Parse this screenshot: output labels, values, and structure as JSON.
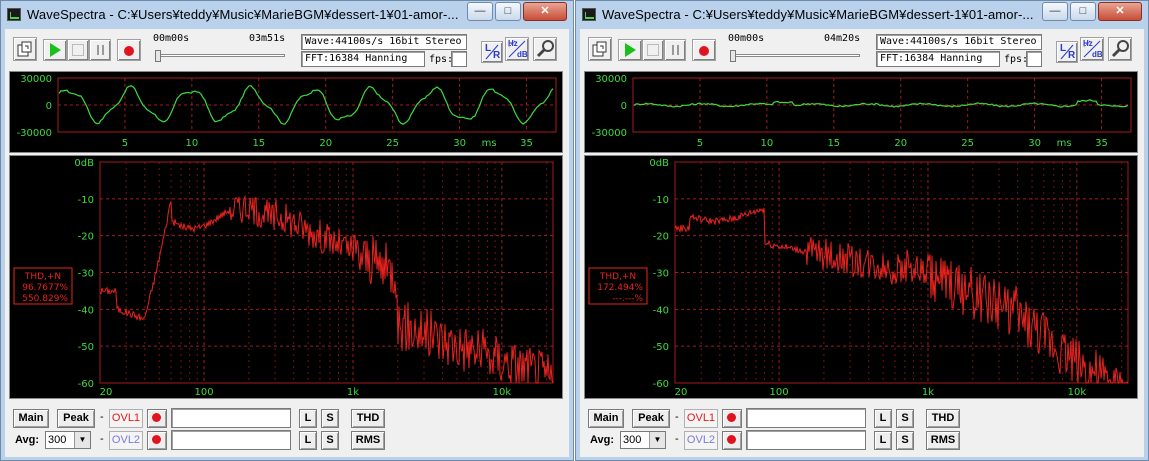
{
  "windows": [
    {
      "title": "WaveSpectra - C:¥Users¥teddy¥Music¥MarieBGM¥dessert-1¥01-amor-...",
      "titlebar_buttons": {
        "min": "—",
        "max": "□",
        "close": "✕"
      },
      "time_start": "00m00s",
      "time_end": "03m51s",
      "wave_info": "Wave:44100s/s 16bit Stereo",
      "fft_info": "FFT:16384 Hanning",
      "fps_label": "fps:",
      "lr_left": "L",
      "lr_right": "R",
      "hz_top": "Hz",
      "hz_bottom": "dB",
      "osc": {
        "y_labels": [
          "30000",
          "0",
          "-30000"
        ],
        "x_labels": [
          "5",
          "10",
          "15",
          "20",
          "25",
          "30",
          "35"
        ],
        "x_unit": "ms"
      },
      "spectrum": {
        "y_labels": [
          "0dB",
          "-10",
          "-20",
          "-30",
          "-40",
          "-50",
          "-60"
        ],
        "x_labels": [
          "20",
          "100",
          "1k",
          "10k"
        ],
        "thd_title": "THD,+N",
        "thd_value1": "96.7677%",
        "thd_value2": "550.829%"
      },
      "bottom": {
        "main": "Main",
        "peak": "Peak",
        "dash1": "-",
        "ovl1": "OVL1",
        "avg_label": "Avg:",
        "avg_value": "300",
        "dash2": "-",
        "ovl2": "OVL2",
        "l": "L",
        "s": "S",
        "thd": "THD",
        "rms": "RMS"
      }
    },
    {
      "title": "WaveSpectra - C:¥Users¥teddy¥Music¥MarieBGM¥dessert-1¥01-amor-...",
      "titlebar_buttons": {
        "min": "—",
        "max": "□",
        "close": "✕"
      },
      "time_start": "00m00s",
      "time_end": "04m20s",
      "wave_info": "Wave:44100s/s 16bit Stereo",
      "fft_info": "FFT:16384 Hanning",
      "fps_label": "fps:",
      "lr_left": "L",
      "lr_right": "R",
      "hz_top": "Hz",
      "hz_bottom": "dB",
      "osc": {
        "y_labels": [
          "30000",
          "0",
          "-30000"
        ],
        "x_labels": [
          "5",
          "10",
          "15",
          "20",
          "25",
          "30",
          "35"
        ],
        "x_unit": "ms"
      },
      "spectrum": {
        "y_labels": [
          "0dB",
          "-10",
          "-20",
          "-30",
          "-40",
          "-50",
          "-60"
        ],
        "x_labels": [
          "20",
          "100",
          "1k",
          "10k"
        ],
        "thd_title": "THD,+N",
        "thd_value1": "172.494%",
        "thd_value2": "---.---%"
      },
      "bottom": {
        "main": "Main",
        "peak": "Peak",
        "dash1": "-",
        "ovl1": "OVL1",
        "avg_label": "Avg:",
        "avg_value": "300",
        "dash2": "-",
        "ovl2": "OVL2",
        "l": "L",
        "s": "S",
        "thd": "THD",
        "rms": "RMS"
      }
    }
  ],
  "colors": {
    "wave_trace": "#3cdc3c",
    "spectrum_trace": "#e8231e",
    "grid": "#a31d1d",
    "axis_label": "#3cdc3c",
    "ovl1_text": "#e01c1c",
    "ovl2_text": "#7a7adc",
    "record": "#e0141e",
    "play": "#19c019"
  }
}
